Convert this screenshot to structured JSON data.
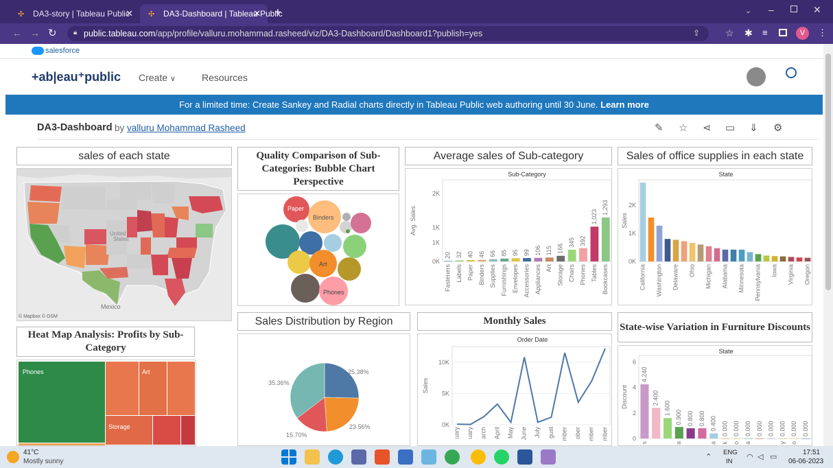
{
  "browser": {
    "tabs": [
      {
        "title": "DA3-story | Tableau Public"
      },
      {
        "title": "DA3-Dashboard | Tableau Public"
      }
    ],
    "url_domain": "public.tableau.com",
    "url_path": "/app/profile/valluru.mohammad.rasheed/viz/DA3-Dashboard/Dashboard1?publish=yes",
    "profile_initial": "V"
  },
  "salesforce": {
    "label": "salesforce"
  },
  "nav": {
    "logo": "+ab|eau⁺public",
    "create": "Create",
    "resources": "Resources"
  },
  "banner": {
    "text": "For a limited time: Create Sankey and Radial charts directly in Tableau Public web authoring until 30 June.",
    "link": "Learn more"
  },
  "viz": {
    "title": "DA3-Dashboard",
    "by": "by",
    "author": "valluru Mohammad Rasheed"
  },
  "map": {
    "title": "sales of each state",
    "credit": "© Mapbox © OSM",
    "country_label": "Mexico",
    "label_states": "States",
    "label_united": "United"
  },
  "bubble": {
    "title": "Quality Comparison of Sub-Categories: Bubble Chart Perspective",
    "labels": [
      "Paper",
      "Binders",
      "Art",
      "Phones"
    ]
  },
  "heatmap": {
    "title": "Heat Map Analysis: Profits by Sub-Category",
    "labels": [
      "Phones",
      "Art",
      "Storage"
    ]
  },
  "pie": {
    "title": "Sales Distribution by Region"
  },
  "chart_data": [
    {
      "type": "bar",
      "title": "Average sales of Sub-category",
      "header": "Sub-Category",
      "ylabel": "Avg. Sales",
      "yticks": [
        "0K",
        "1K",
        "1K",
        "2K"
      ],
      "ylim": [
        0,
        2400
      ],
      "categories": [
        "Fasteners",
        "Labels",
        "Paper",
        "Binders",
        "Supplies",
        "Furnishings",
        "Envelopes",
        "Accessories",
        "Appliances",
        "Art",
        "Storage",
        "Chairs",
        "Phones",
        "Tables",
        "Bookcases"
      ],
      "values": [
        20,
        32,
        40,
        46,
        66,
        85,
        95,
        99,
        106,
        115,
        166,
        345,
        392,
        1023,
        1293
      ],
      "data_labels": [
        "20",
        "32",
        "40",
        "46",
        "66",
        "85",
        "95",
        "99",
        "106",
        "115",
        "166",
        "345",
        "392",
        "1,023",
        "1,293"
      ],
      "colors": [
        "#7fb1d6",
        "#9dd17b",
        "#d3c24b",
        "#e0a37a",
        "#8fbcb8",
        "#6aa88f",
        "#e0c34a",
        "#3f6d9e",
        "#b07ab0",
        "#c58a5f",
        "#6b6b6b",
        "#9ad77a",
        "#f2a0a0",
        "#c23a68",
        "#8bc785"
      ]
    },
    {
      "type": "bar",
      "title": "Sales of office supplies in each state",
      "header": "State",
      "ylabel": "Sales",
      "yticks": [
        "0K",
        "1K",
        "2K"
      ],
      "ylim": [
        0,
        2900
      ],
      "categories": [
        "California",
        "",
        "Washington",
        "",
        "Delaware",
        "",
        "Ohio",
        "",
        "Michigan",
        "",
        "Alabama",
        "",
        "Minnesota",
        "",
        "Pennsylvania",
        "",
        "Iowa",
        "",
        "Virginia",
        "",
        "Oregon"
      ],
      "values": [
        2800,
        1560,
        1270,
        800,
        770,
        720,
        660,
        600,
        540,
        470,
        420,
        420,
        420,
        330,
        260,
        210,
        190,
        180,
        160,
        140,
        130
      ],
      "colors": [
        "#a6cee3",
        "#f28e2b",
        "#8fa4d6",
        "#3e5a8c",
        "#d9a545",
        "#eea17a",
        "#f2c36b",
        "#b79a75",
        "#e0808a",
        "#d46c8d",
        "#5c6aa8",
        "#3f7fa8",
        "#4d9dc0",
        "#7ab5cf",
        "#59a14f",
        "#b5c843",
        "#d3b136",
        "#8a6d3b",
        "#b04a5a",
        "#c84a4a",
        "#a0525c"
      ]
    },
    {
      "type": "pie",
      "title": "Sales Distribution by Region",
      "values": [
        25.38,
        23.56,
        15.7,
        35.36
      ],
      "labels": [
        "25.38%",
        "23.56%",
        "15.70%",
        "35.36%"
      ],
      "colors": [
        "#4e79a7",
        "#f28e2b",
        "#e15759",
        "#76b7b2"
      ]
    },
    {
      "type": "line",
      "title": "Monthly Sales",
      "header": "Order Date",
      "ylabel": "Sales",
      "yticks": [
        "0K",
        "5K",
        "10K"
      ],
      "ylim": [
        0,
        12500
      ],
      "categories": [
        "January",
        "February",
        "March",
        "April",
        "May",
        "June",
        "July",
        "August",
        "September",
        "October",
        "November",
        "December"
      ],
      "xtick_labels": [
        "uary",
        "uary",
        "arch",
        "April",
        "May",
        "June",
        "July",
        "gust",
        "mber",
        "ober",
        "mber",
        "mber"
      ],
      "values": [
        100,
        50,
        1300,
        3300,
        400,
        10800,
        400,
        1200,
        11500,
        3600,
        7000,
        12200
      ]
    },
    {
      "type": "bar",
      "title": "State-wise Variation in Furniture Discounts",
      "header": "State",
      "ylabel": "Discount",
      "yticks": [
        "0",
        "2",
        "4",
        "6"
      ],
      "ylim": [
        0,
        6.5
      ],
      "values": [
        4.24,
        2.4,
        1.6,
        0.9,
        0.8,
        0.8,
        0.4,
        0,
        0,
        0,
        0,
        0,
        0,
        0,
        0
      ],
      "data_labels": [
        "4.240",
        "2.400",
        "1.600",
        "0.900",
        "0.800",
        "0.800",
        "0.400",
        "0.000",
        "0.000",
        "0.000",
        "0.000",
        "0.000",
        "0.000",
        "0.000",
        "0.000"
      ],
      "xtick_labels": [
        "s",
        "",
        "",
        "a",
        "",
        "",
        "a",
        "k",
        "o",
        "a",
        "",
        "",
        "y",
        "o",
        ""
      ],
      "colors": [
        "#c89ac8",
        "#f2b8c6",
        "#9ad77a",
        "#59a14f",
        "#8c3a8c",
        "#d36aa0",
        "#a6cee3",
        "#f28e2b",
        "#d3c24b",
        "#6aa88f",
        "#e15759",
        "#8fa4d6",
        "#b5c843",
        "#edc948",
        "#4e79a7"
      ]
    }
  ],
  "taskbar": {
    "temp": "41°C",
    "weather": "Mostly sunny",
    "lang": "ENG",
    "region": "IN",
    "time": "17:51",
    "date": "06-06-2023"
  }
}
